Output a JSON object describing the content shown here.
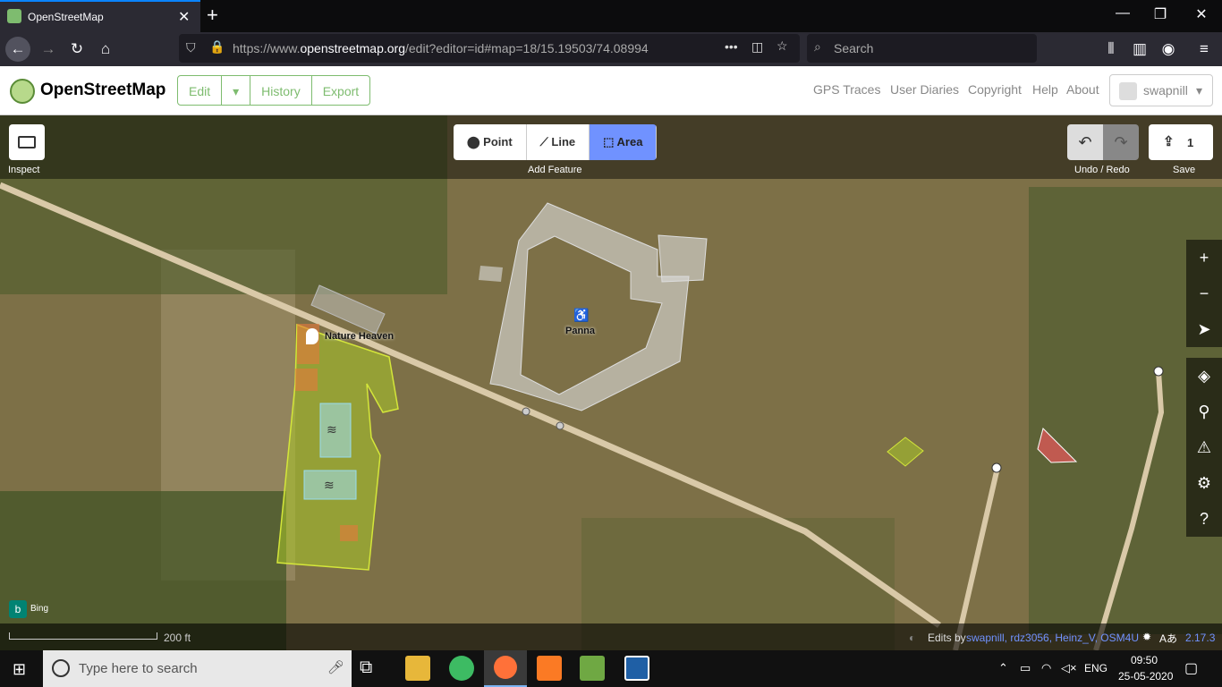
{
  "browser": {
    "tab_title": "OpenStreetMap",
    "new_tab_icon": "plus-icon",
    "url_prefix": "https://www.",
    "url_domain": "openstreetmap.org",
    "url_path": "/edit?editor=id#map=18/15.19503/74.08994",
    "search_placeholder": "Search",
    "more_icon": "•••"
  },
  "osm": {
    "site_name": "OpenStreetMap",
    "edit_label": "Edit",
    "history_label": "History",
    "export_label": "Export",
    "nav": [
      "GPS Traces",
      "User Diaries",
      "Copyright",
      "Help",
      "About"
    ],
    "username": "swapnill"
  },
  "editor": {
    "inspect_label": "Inspect",
    "point_label": "Point",
    "line_label": "Line",
    "area_label": "Area",
    "add_feature_label": "Add Feature",
    "undo_redo_label": "Undo / Redo",
    "save_label": "Save",
    "save_count": "1",
    "map_labels": {
      "nature_heaven": "Nature Heaven",
      "panna": "Panna"
    },
    "bing_label": "Bing",
    "scale_label": "200 ft",
    "edits_by_prefix": "Edits by",
    "edits_by_users": "swapnill, rdz3056, Heinz_V, OSM4U",
    "version": "2.17.3",
    "colors": {
      "accent": "#7092ff",
      "osm_green": "#7ebc6f",
      "road": "#d9c9a8"
    }
  },
  "taskbar": {
    "search_placeholder": "Type here to search",
    "language": "ENG",
    "time": "09:50",
    "date": "25-05-2020"
  }
}
